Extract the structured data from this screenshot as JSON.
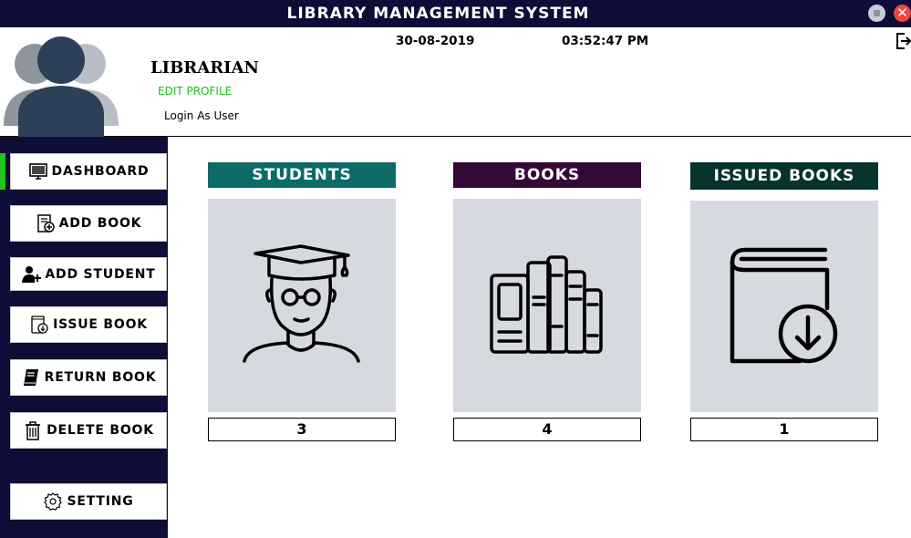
{
  "window": {
    "title": "LIBRARY MANAGEMENT SYSTEM",
    "close_glyph": "✕"
  },
  "header": {
    "role": "LIBRARIAN",
    "edit_profile": "EDIT PROFILE",
    "login_as": "Login As User",
    "date": "30-08-2019",
    "time": "03:52:47 PM",
    "icons": {
      "avatar": "users-group-icon",
      "logout": "logout-icon"
    }
  },
  "sidebar": {
    "active": "dashboard",
    "items": [
      {
        "label": "DASHBOARD",
        "icon": "monitor-icon"
      },
      {
        "label": "ADD BOOK",
        "icon": "add-book-icon"
      },
      {
        "label": "ADD STUDENT",
        "icon": "add-user-icon"
      },
      {
        "label": "ISSUE BOOK",
        "icon": "issue-book-icon"
      },
      {
        "label": "RETURN BOOK",
        "icon": "book-icon"
      },
      {
        "label": "DELETE BOOK",
        "icon": "trash-icon"
      },
      {
        "label": "SETTING",
        "icon": "settings-icon"
      }
    ]
  },
  "cards": [
    {
      "title": "STUDENTS",
      "count": "3",
      "color": "#0c6b66",
      "icon": "student-icon"
    },
    {
      "title": "BOOKS",
      "count": "4",
      "color": "#320a35",
      "icon": "books-icon"
    },
    {
      "title": "ISSUED BOOKS",
      "count": "1",
      "color": "#07332f",
      "icon": "book-download-icon"
    }
  ],
  "colors": {
    "navy": "#0e0d38",
    "active_indicator": "#22c322",
    "edit_profile": "#1dbf1d",
    "card_bg": "#d7d9e0"
  }
}
